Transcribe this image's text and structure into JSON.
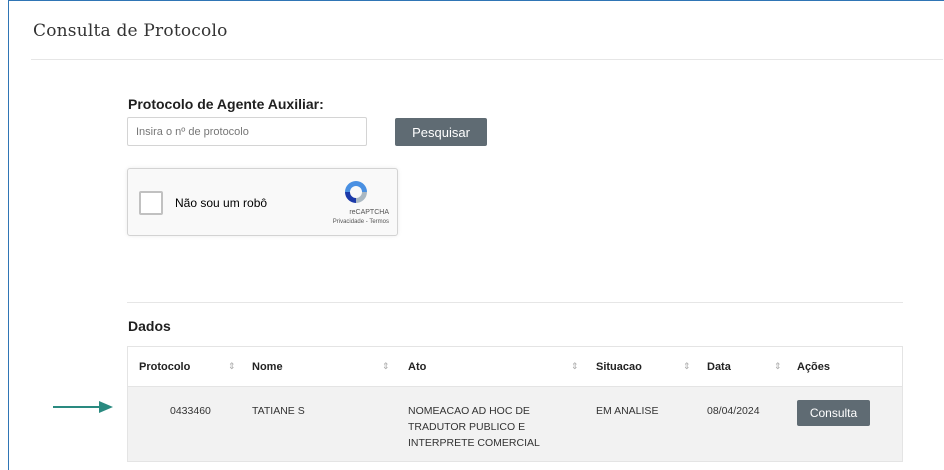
{
  "header": {
    "title": "Consulta de Protocolo"
  },
  "form": {
    "label": "Protocolo de Agente Auxiliar:",
    "placeholder": "Insira o nº de protocolo",
    "search_label": "Pesquisar"
  },
  "captcha": {
    "label": "Não sou um robô",
    "brand": "reCAPTCHA",
    "links": "Privacidade - Termos",
    "icon": "recaptcha-logo-icon"
  },
  "results": {
    "title": "Dados",
    "columns": [
      "Protocolo",
      "Nome",
      "Ato",
      "Situacao",
      "Data",
      "Ações"
    ],
    "rows": [
      {
        "protocolo": "0433460",
        "nome": "TATIANE S",
        "ato": "NOMEACAO AD HOC DE TRADUTOR PUBLICO E INTERPRETE COMERCIAL",
        "situacao": "EM ANALISE",
        "data": "08/04/2024",
        "acao": "Consulta"
      }
    ]
  },
  "colors": {
    "button": "#5f6b73",
    "arrow": "#2a8a80",
    "frame": "#2f75b5"
  }
}
